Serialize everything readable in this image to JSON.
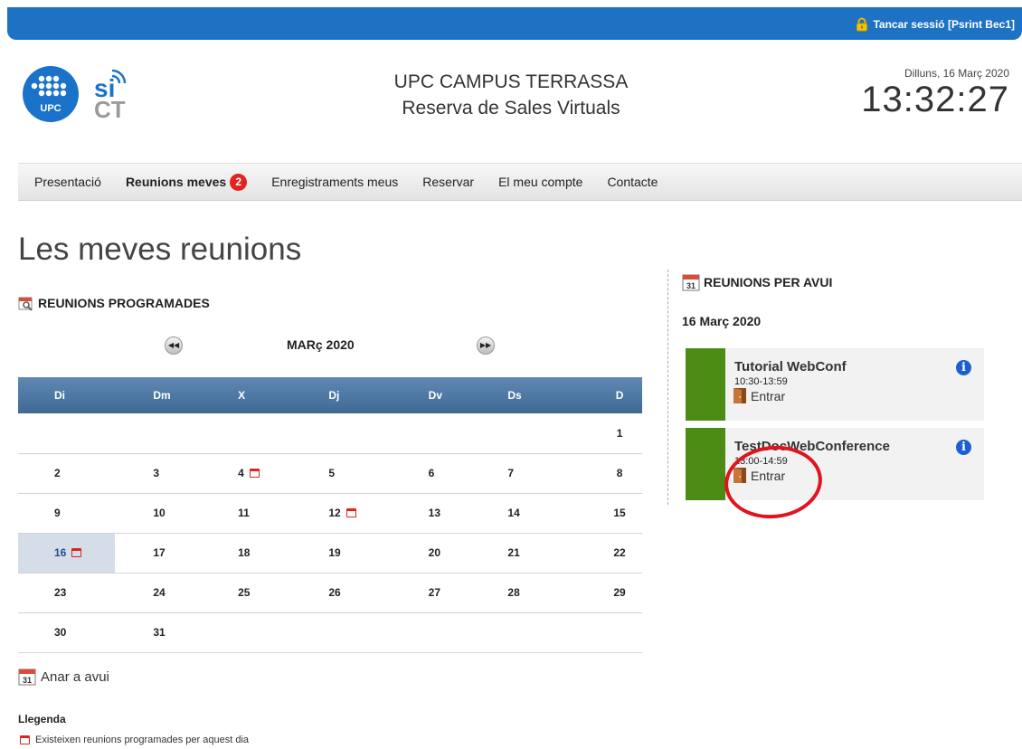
{
  "topbar": {
    "logout_label": "Tancar sessió [Psrint Bec1]"
  },
  "header": {
    "title_line1": "UPC CAMPUS TERRASSA",
    "title_line2": "Reserva de Sales Virtuals",
    "date": "Dilluns, 16 Març 2020",
    "time": "13:32:27",
    "logo_text": "UPC"
  },
  "nav": {
    "items": [
      {
        "label": "Presentació"
      },
      {
        "label": "Reunions meves",
        "badge": "2"
      },
      {
        "label": "Enregistraments meus"
      },
      {
        "label": "Reservar"
      },
      {
        "label": "El meu compte"
      },
      {
        "label": "Contacte"
      }
    ]
  },
  "page": {
    "title": "Les meves reunions"
  },
  "scheduled": {
    "heading": "REUNIONS PROGRAMADES",
    "month": "MARç 2020",
    "weekdays": [
      "Di",
      "Dm",
      "X",
      "Dj",
      "Dv",
      "Ds",
      "D"
    ],
    "weeks": [
      [
        "",
        "",
        "",
        "",
        "",
        "",
        "1"
      ],
      [
        "2",
        "3",
        "4",
        "5",
        "6",
        "7",
        "8"
      ],
      [
        "9",
        "10",
        "11",
        "12",
        "13",
        "14",
        "15"
      ],
      [
        "16",
        "17",
        "18",
        "19",
        "20",
        "21",
        "22"
      ],
      [
        "23",
        "24",
        "25",
        "26",
        "27",
        "28",
        "29"
      ],
      [
        "30",
        "31",
        "",
        "",
        "",
        "",
        ""
      ]
    ],
    "days_with_meetings": [
      "4",
      "12",
      "16"
    ],
    "today": "16",
    "goto_today": "Anar a avui",
    "legend_title": "Llegenda",
    "legend_item": "Existeixen reunions programades per aquest dia"
  },
  "today_panel": {
    "heading": "REUNIONS PER AVUI",
    "date": "16 Març 2020",
    "meetings": [
      {
        "name": "Tutorial WebConf",
        "time": "10:30-13:59",
        "enter": "Entrar"
      },
      {
        "name": "TestDocWebConference",
        "time": "13:00-14:59",
        "enter": "Entrar"
      }
    ]
  },
  "colors": {
    "topbar": "#1e72c4",
    "badge": "#e32222",
    "meeting_bar": "#4c8c14",
    "header_row": "#4f7aa5",
    "annotation": "#e0141e"
  }
}
